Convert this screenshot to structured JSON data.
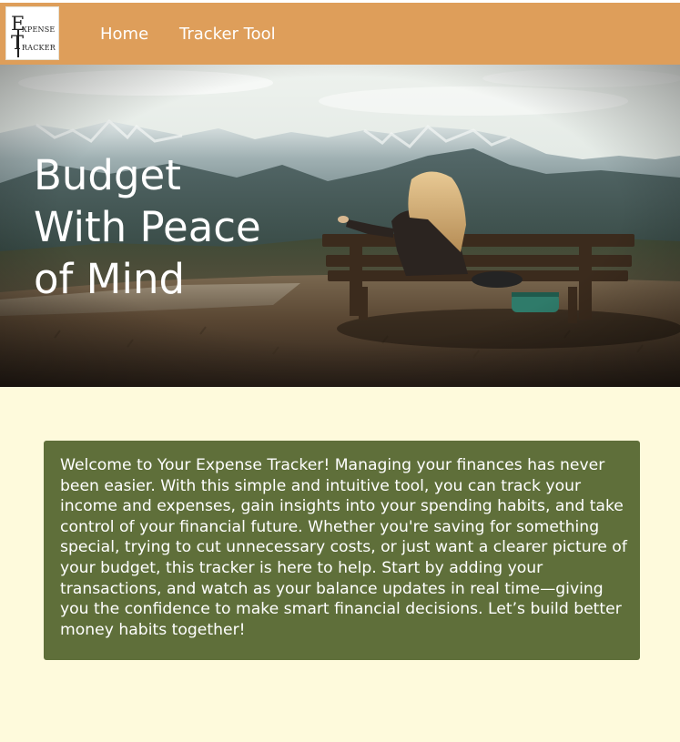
{
  "nav": {
    "logo": {
      "letter_e": "E",
      "word_e": "XPENSE",
      "letter_t": "T",
      "word_t": "RACKER"
    },
    "links": [
      {
        "label": "Home"
      },
      {
        "label": "Tracker Tool"
      }
    ]
  },
  "hero": {
    "title_lines": [
      "Budget",
      "With Peace",
      "of Mind"
    ]
  },
  "welcome": {
    "text": "Welcome to Your Expense Tracker! Managing your finances has never been easier. With this simple and intuitive tool, you can track your income and expenses, gain insights into your spending habits, and take control of your financial future. Whether you're saving for something special, trying to cut unnecessary costs, or just want a clearer picture of your budget, this tracker is here to help. Start by adding your transactions, and watch as your balance updates in real time—giving you the confidence to make smart financial decisions. Let’s build better money habits together!"
  },
  "colors": {
    "navbar": "#de9e5a",
    "page_background": "#fefadc",
    "welcome_box": "#5f6f3a",
    "text_light": "#ffffff"
  }
}
